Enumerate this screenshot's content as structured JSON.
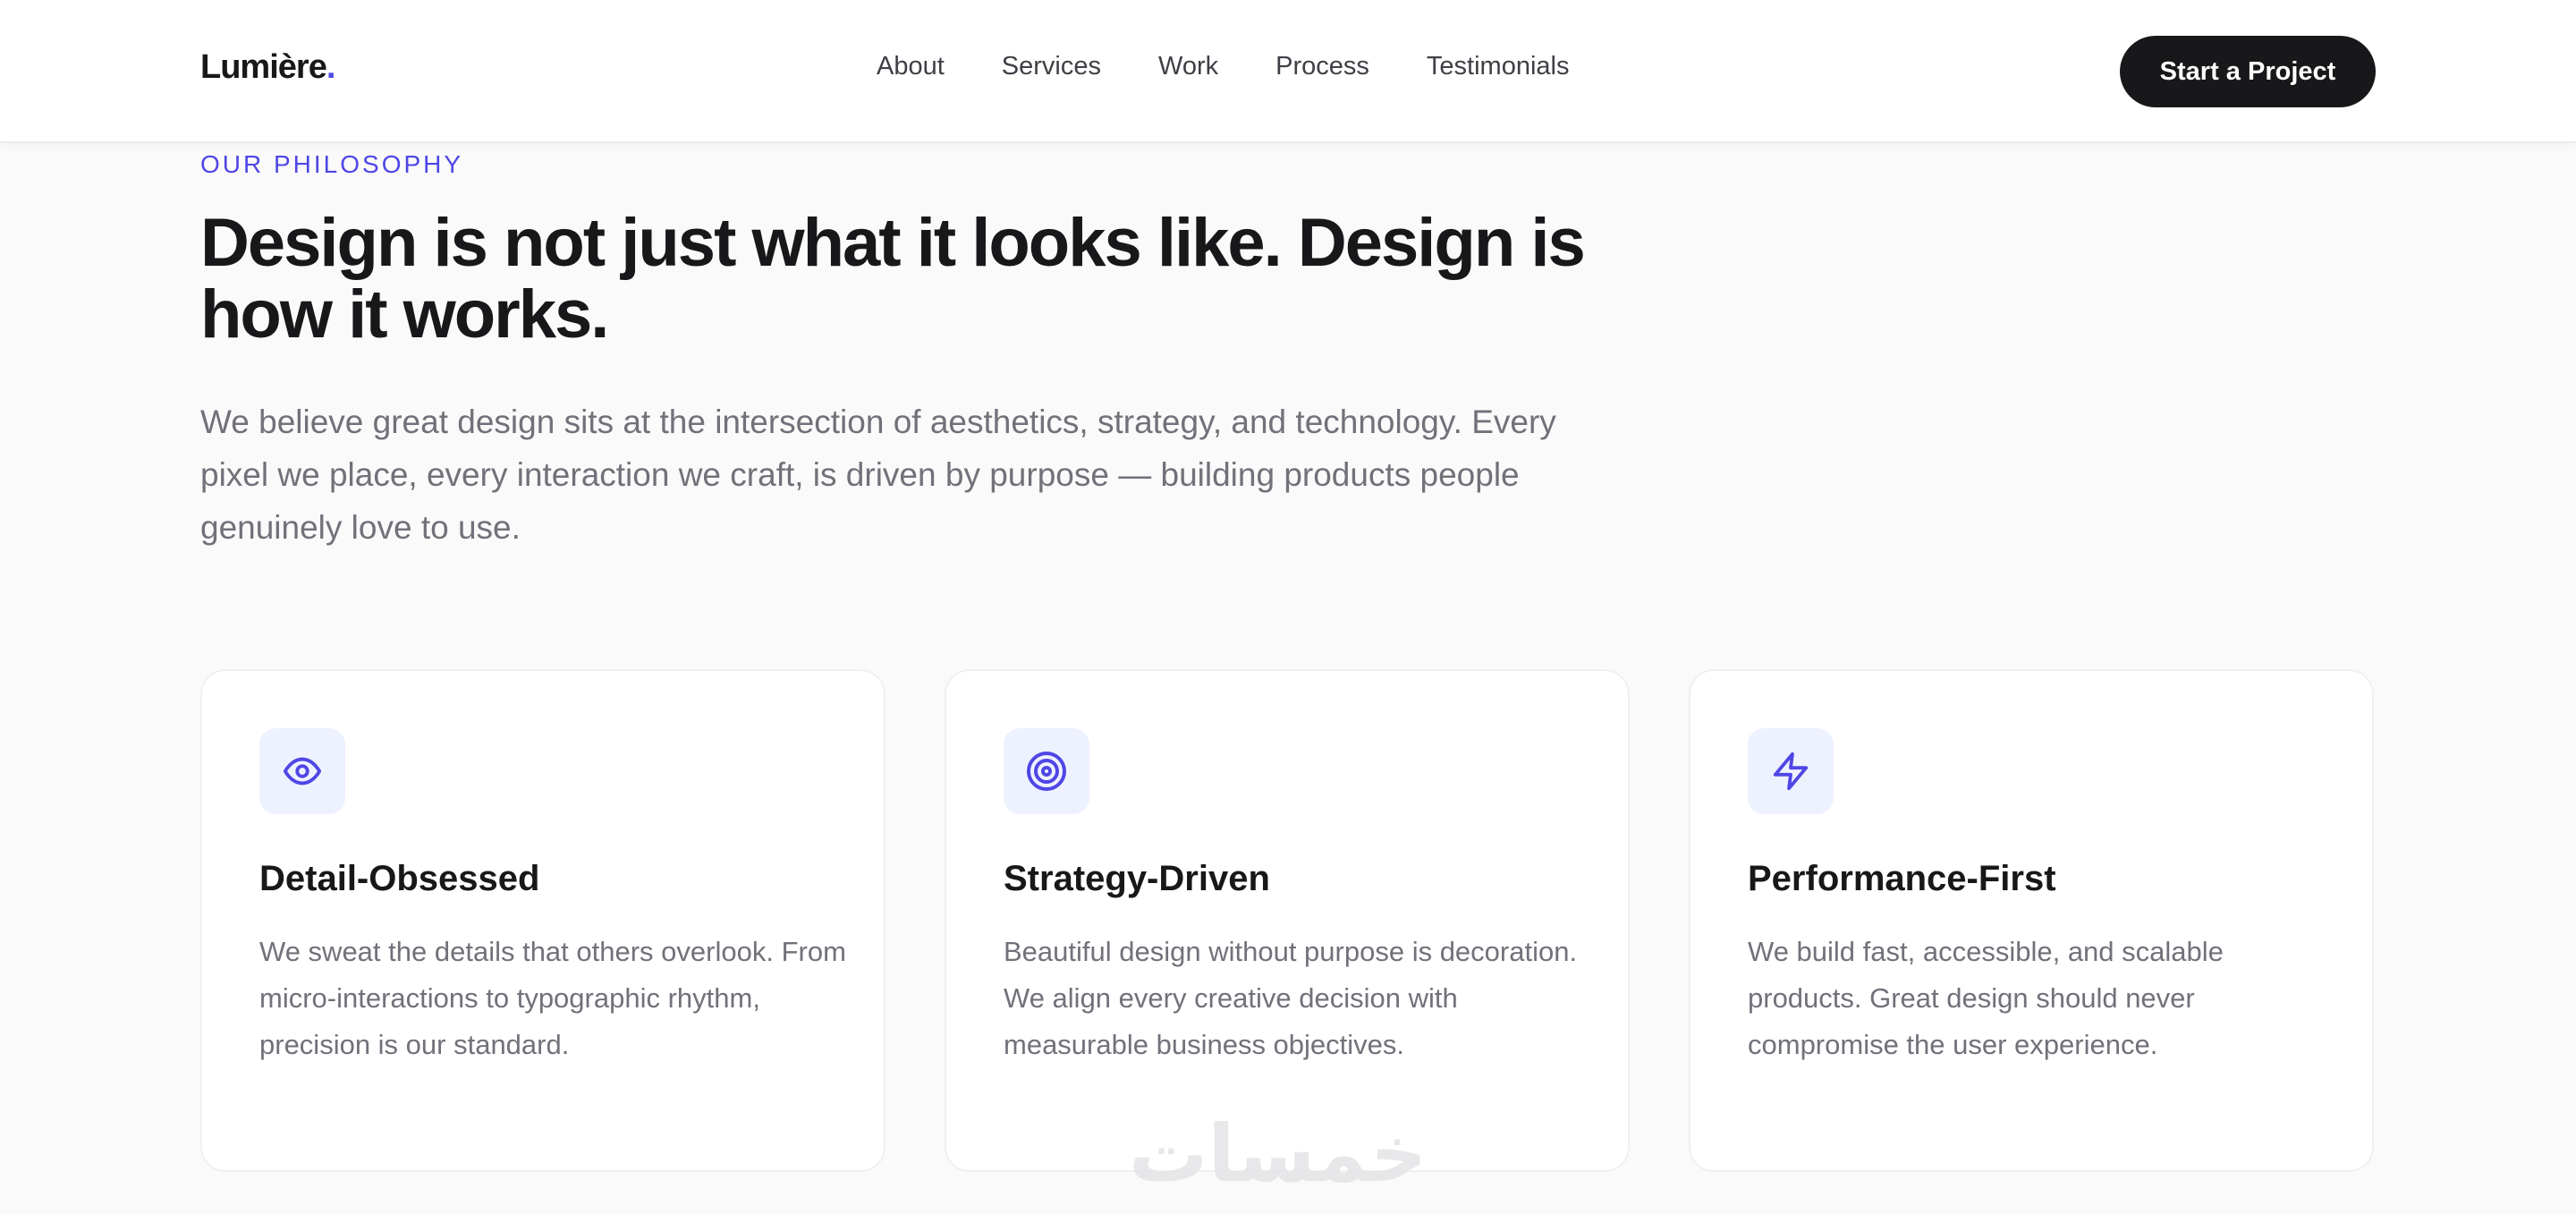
{
  "navbar": {
    "brand": "Lumière",
    "brand_dot": ".",
    "links": [
      "About",
      "Services",
      "Work",
      "Process",
      "Testimonials"
    ],
    "cta_label": "Start a Project"
  },
  "philosophy": {
    "eyebrow": "OUR PHILOSOPHY",
    "headline": "Design is not just what it looks like. Design is how it works.",
    "lede": "We believe great design sits at the intersection of aesthetics, strategy, and technology. Every pixel we place, every interaction we craft, is driven by purpose — building products people genuinely love to use."
  },
  "cards": [
    {
      "icon": "eye-icon",
      "title": "Detail-Obsessed",
      "text": "We sweat the details that others overlook. From micro-interactions to typographic rhythm, precision is our standard."
    },
    {
      "icon": "target-icon",
      "title": "Strategy-Driven",
      "text": "Beautiful design without purpose is decoration. We align every creative decision with measurable business objectives."
    },
    {
      "icon": "lightning-icon",
      "title": "Performance-First",
      "text": "We build fast, accessible, and scalable products. Great design should never compromise the user experience."
    }
  ],
  "watermark": "خمسات",
  "colors": {
    "accent": "#4f46e5",
    "icon_bg": "#eef2ff",
    "text_dark": "#18181b",
    "text_muted": "#71717a",
    "page_bg": "#fafafa"
  }
}
